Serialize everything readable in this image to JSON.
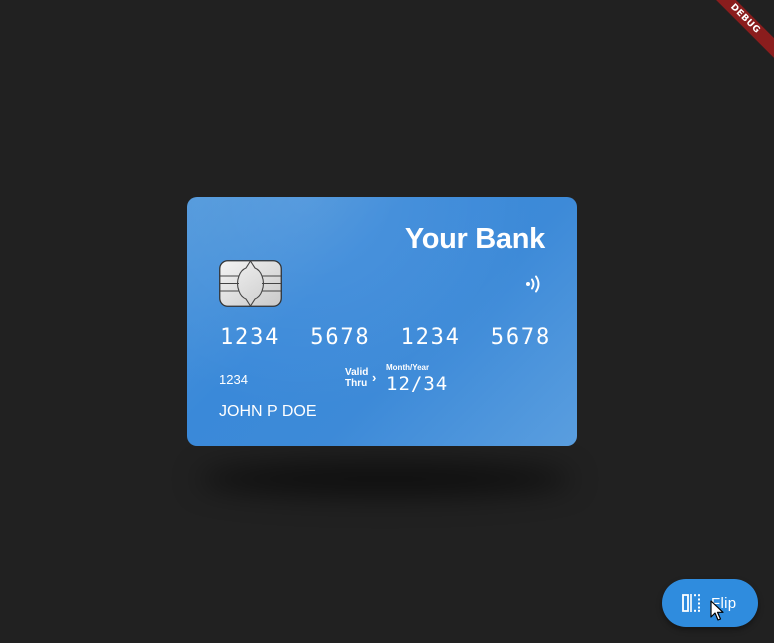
{
  "debug_banner": "DEBUG",
  "card": {
    "bank_name": "Your Bank",
    "number": "1234  5678  1234  5678",
    "first_digits": "1234",
    "valid_label_line1": "Valid",
    "valid_label_line2": "Thru",
    "arrow": "›",
    "month_year_label": "Month/Year",
    "expiry": "12/34",
    "holder_name": "JOHN P DOE",
    "chip_icon": "chip-icon",
    "contactless_icon": "contactless-icon"
  },
  "fab": {
    "label": "Flip",
    "icon": "flip-icon"
  },
  "colors": {
    "background": "#212121",
    "card": "#3d8ad8",
    "fab": "#2f8cde",
    "debug": "#8a1d1d"
  }
}
